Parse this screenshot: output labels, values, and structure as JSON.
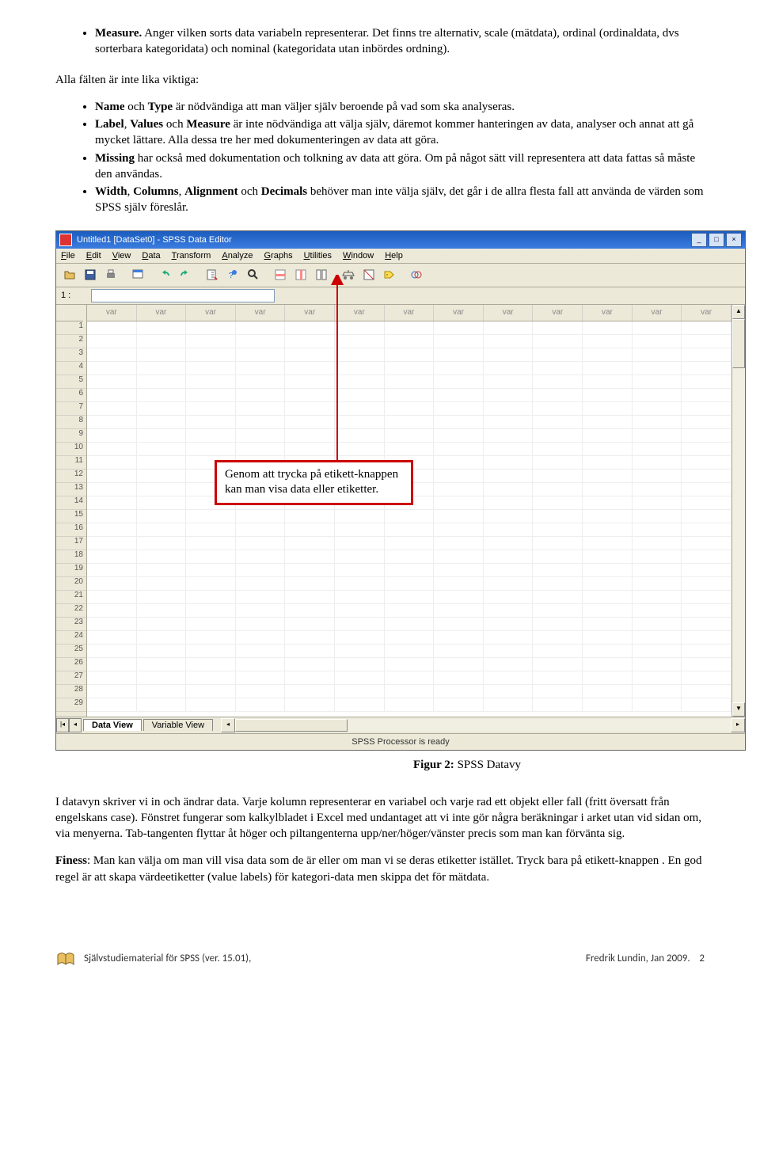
{
  "doc": {
    "bullet1_lead": "Measure.",
    "bullet1_text": " Anger vilken sorts data variabeln representerar. Det finns tre alternativ, scale (mätdata), ordinal (ordinaldata, dvs sorterbara kategoridata) och nominal (kategoridata utan inbördes ordning).",
    "para1": "Alla fälten är inte lika viktiga:",
    "b2a": "Name",
    "b2b": " och ",
    "b2c": "Type",
    "b2d": " är nödvändiga att man väljer själv beroende på vad som ska analyseras.",
    "b3a": "Label",
    "b3b": ", ",
    "b3c": "Values",
    "b3d": " och ",
    "b3e": "Measure",
    "b3f": " är inte nödvändiga att välja själv, däremot kommer hanteringen  av data, analyser och annat att gå mycket lättare. Alla dessa tre her med dokumenteringen av data att göra.",
    "b4a": "Missing",
    "b4b": " har också med dokumentation och tolkning av data att göra. Om på något sätt vill representera att data fattas så måste den användas.",
    "b5a": "Width",
    "b5b": ", ",
    "b5c": "Columns",
    "b5d": ", ",
    "b5e": "Alignment",
    "b5f": " och ",
    "b5g": "Decimals",
    "b5h": " behöver man inte välja själv, det går i de allra flesta fall att använda de värden som SPSS själv föreslår.",
    "callout": "Genom att trycka på etikett-knappen kan man visa data eller etiketter.",
    "figcap_bold": "Figur 2:",
    "figcap_text": " SPSS Datavy",
    "para2": "I datavyn skriver vi in och ändrar data. Varje kolumn representerar en variabel och varje rad ett objekt eller fall (fritt översatt från engelskans case). Fönstret fungerar som kalkylbladet i Excel med undantaget att vi inte gör några beräkningar i arket utan vid sidan om, via menyerna. Tab-tangenten flyttar åt höger och piltangenterna upp/ner/höger/vänster precis som man kan förvänta sig.",
    "para3_lead": "Finess",
    "para3": ": Man kan välja om man vill visa data som de är eller om man vi se deras etiketter istället. Tryck bara på etikett-knappen . En god regel är att skapa värdeetiketter (value labels) för kategori-data men skippa det för mätdata."
  },
  "spss": {
    "title": "Untitled1 [DataSet0] - SPSS Data Editor",
    "menus": [
      "File",
      "Edit",
      "View",
      "Data",
      "Transform",
      "Analyze",
      "Graphs",
      "Utilities",
      "Window",
      "Help"
    ],
    "cellref": "1 :",
    "colhdr": "var",
    "rows": [
      "1",
      "2",
      "3",
      "4",
      "5",
      "6",
      "7",
      "8",
      "9",
      "10",
      "11",
      "12",
      "13",
      "14",
      "15",
      "16",
      "17",
      "18",
      "19",
      "20",
      "21",
      "22",
      "23",
      "24",
      "25",
      "26",
      "27",
      "28",
      "29"
    ],
    "tab1": "Data View",
    "tab2": "Variable View",
    "status": "SPSS Processor is ready"
  },
  "footer": {
    "left": "Självstudiematerial för SPSS (ver. 15.01),",
    "right": "Fredrik Lundin, Jan 2009.",
    "page": "2"
  }
}
